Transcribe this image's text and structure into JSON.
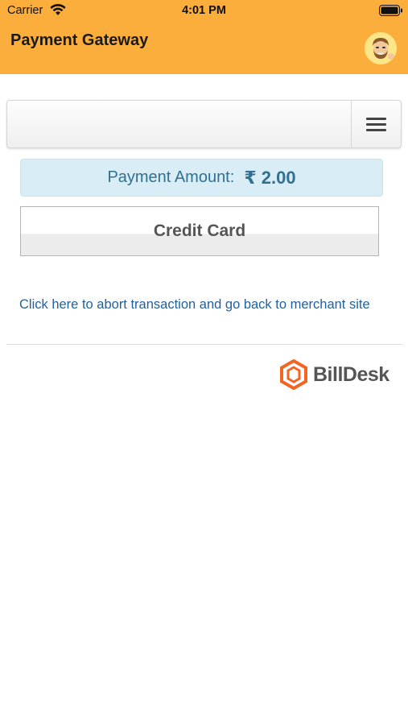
{
  "status_bar": {
    "carrier": "Carrier",
    "time": "4:01 PM",
    "wifi_icon": "wifi-icon",
    "battery_icon": "battery-icon"
  },
  "nav": {
    "title": "Payment Gateway",
    "avatar_icon": "memoji-avatar",
    "background_color": "#fcae3c"
  },
  "toolbar": {
    "menu_icon": "hamburger-menu-icon"
  },
  "payment": {
    "amount_label": "Payment Amount:",
    "amount_value": "₹ 2.00",
    "accent_color": "#31708f"
  },
  "methods": {
    "credit_card_label": "Credit Card"
  },
  "abort": {
    "link_text": "Click here to abort transaction and go back to merchant site",
    "link_color": "#23619d"
  },
  "footer": {
    "logo_text": "BillDesk",
    "logo_color": "#f26522"
  }
}
